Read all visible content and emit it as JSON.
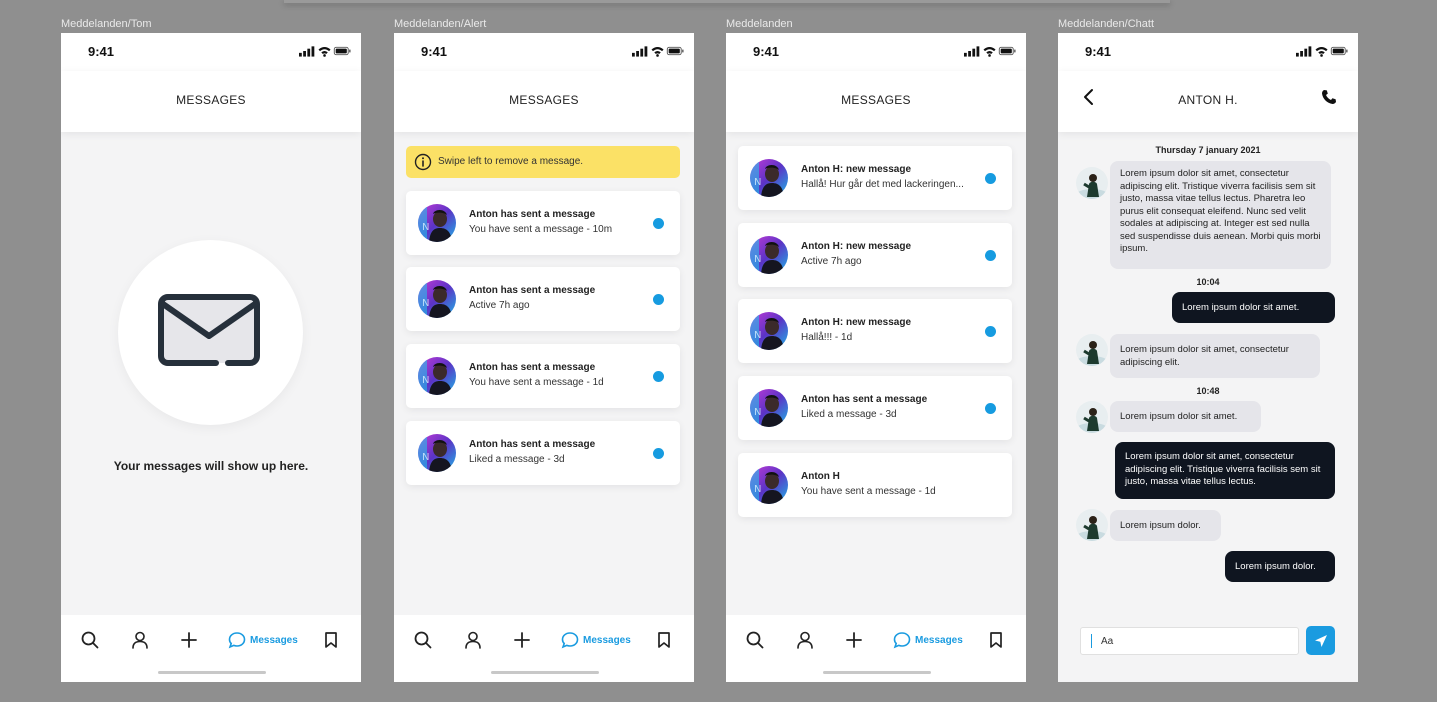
{
  "canvas_labels": [
    "Meddelanden/Tom",
    "Meddelanden/Alert",
    "Meddelanden",
    "Meddelanden/Chatt"
  ],
  "status_time": "9:41",
  "nav": {
    "messages_label": "Messages"
  },
  "screen_tom": {
    "title": "MESSAGES",
    "empty_text": "Your messages will show up here."
  },
  "screen_alert": {
    "title": "MESSAGES",
    "alert_text": "Swipe left to remove a message.",
    "items": [
      {
        "title": "Anton has sent a message",
        "subtitle": "You have sent a message - 10m",
        "unread": true
      },
      {
        "title": "Anton has sent a message",
        "subtitle": "Active 7h ago",
        "unread": true
      },
      {
        "title": "Anton has sent a message",
        "subtitle": "You have sent a message - 1d",
        "unread": true
      },
      {
        "title": "Anton has sent a message",
        "subtitle": "Liked a message - 3d",
        "unread": true
      }
    ]
  },
  "screen_list": {
    "title": "MESSAGES",
    "items": [
      {
        "title": "Anton H: new message",
        "subtitle": "Hallå! Hur går det med lackeringen...",
        "unread": true
      },
      {
        "title": "Anton H: new message",
        "subtitle": "Active 7h ago",
        "unread": true
      },
      {
        "title": "Anton H: new message",
        "subtitle": "Hallå!!! - 1d",
        "unread": true
      },
      {
        "title": "Anton has sent a message",
        "subtitle": "Liked a message - 3d",
        "unread": true
      },
      {
        "title": "Anton H",
        "subtitle": "You have sent a message - 1d",
        "unread": false
      }
    ]
  },
  "screen_chat": {
    "title": "ANTON H.",
    "date": "Thursday 7 january 2021",
    "time1": "10:04",
    "time2": "10:48",
    "messages": [
      "Lorem ipsum dolor sit amet, consectetur adipiscing elit. Tristique viverra facilisis sem sit justo, massa vitae tellus lectus. Pharetra leo purus elit consequat eleifend. Nunc sed velit sodales at adipiscing at. Integer est sed nulla sed suspendisse duis aenean. Morbi quis morbi ipsum.",
      "Lorem ipsum dolor sit amet.",
      "Lorem ipsum dolor sit amet, consectetur adipiscing elit.",
      "Lorem ipsum dolor sit amet.",
      "Lorem ipsum dolor sit amet, consectetur adipiscing elit. Tristique viverra facilisis sem sit justo, massa vitae tellus lectus.",
      "Lorem ipsum dolor.",
      "Lorem ipsum dolor."
    ],
    "input_placeholder": "Aa"
  },
  "colors": {
    "accent": "#1a9be0",
    "alert": "#fbe166",
    "dark_bubble": "#0f1520",
    "light_bubble": "#e5e5ea"
  }
}
